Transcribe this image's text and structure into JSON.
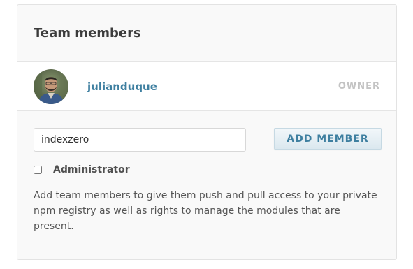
{
  "team": {
    "title": "Team members"
  },
  "member": {
    "username": "julianduque",
    "role": "OWNER",
    "avatar_icon": "user-avatar-photo"
  },
  "add_form": {
    "input_value": "indexzero",
    "button_label": "ADD MEMBER",
    "admin_checkbox_checked": false,
    "admin_label": "Administrator",
    "help_text": "Add team members to give them push and pull access to your private npm registry as well as rights to manage the modules that are present."
  },
  "colors": {
    "link": "#3e7fa0",
    "muted": "#c3c3c3",
    "panel_bg": "#f9f9f9"
  }
}
